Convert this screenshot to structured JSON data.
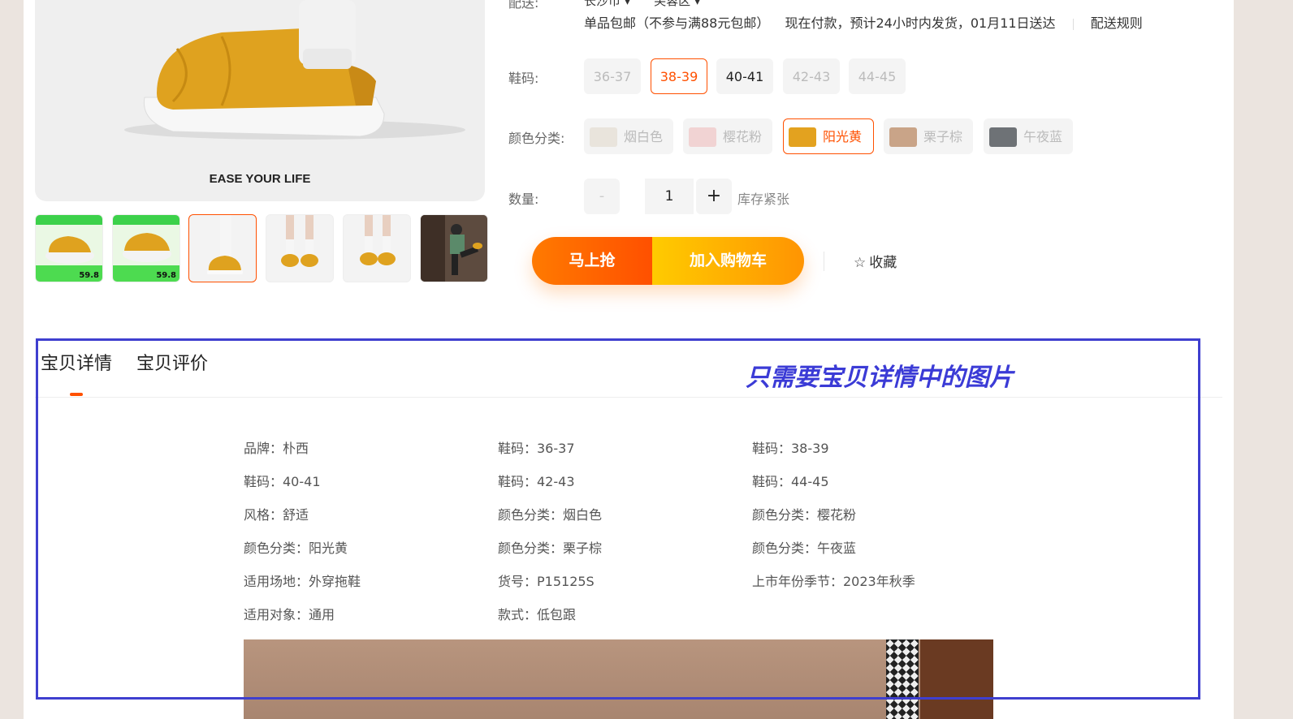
{
  "product": {
    "main_image_caption": "EASE YOUR LIFE",
    "thumbnails": [
      {
        "name": "thumb-1",
        "label": "59.8"
      },
      {
        "name": "thumb-2",
        "label": "59.8"
      },
      {
        "name": "thumb-3",
        "label": ""
      },
      {
        "name": "thumb-4",
        "label": ""
      },
      {
        "name": "thumb-5",
        "label": ""
      },
      {
        "name": "thumb-6",
        "label": ""
      }
    ],
    "selected_thumbnail_index": 3
  },
  "delivery": {
    "label": "配送:",
    "city": "长沙市",
    "district": "芙蓉区",
    "shipping_note": "单品包邮（不参与满88元包邮）",
    "dispatch_note": "现在付款，预计24小时内发货，01月11日送达",
    "rules_link": "配送规则"
  },
  "size": {
    "label": "鞋码:",
    "options": [
      "36-37",
      "38-39",
      "40-41",
      "42-43",
      "44-45"
    ],
    "selected": "38-39",
    "available": [
      "38-39",
      "40-41"
    ]
  },
  "color": {
    "label": "颜色分类:",
    "options": [
      "烟白色",
      "樱花粉",
      "阳光黄",
      "栗子棕",
      "午夜蓝"
    ],
    "selected": "阳光黄",
    "swatch_colors": [
      "#e9e4dc",
      "#f1d3d3",
      "#e3a21f",
      "#c9a488",
      "#6e7276"
    ]
  },
  "quantity": {
    "label": "数量:",
    "minus": "-",
    "value": "1",
    "plus": "+",
    "stock_note": "库存紧张"
  },
  "actions": {
    "buy_now": "马上抢",
    "add_to_cart": "加入购物车",
    "favorite": "收藏",
    "favorite_icon": "☆"
  },
  "tabs": {
    "items": [
      "宝贝详情",
      "宝贝评价"
    ],
    "active": "宝贝详情"
  },
  "attributes": [
    [
      "品牌：朴西",
      "鞋码：36-37",
      "鞋码：38-39"
    ],
    [
      "鞋码：40-41",
      "鞋码：42-43",
      "鞋码：44-45"
    ],
    [
      "风格：舒适",
      "颜色分类：烟白色",
      "颜色分类：樱花粉"
    ],
    [
      "颜色分类：阳光黄",
      "颜色分类：栗子棕",
      "颜色分类：午夜蓝"
    ],
    [
      "适用场地：外穿拖鞋",
      "货号：P15125S",
      "上市年份季节：2023年秋季"
    ],
    [
      "适用对象：通用",
      "款式：低包跟",
      ""
    ]
  ],
  "annotation": {
    "text": "只需要宝贝详情中的图片",
    "color": "#3b3bd6"
  },
  "colors": {
    "accent": "#ff5000",
    "buy_gradient": [
      "#ff7a00",
      "#ff5000"
    ],
    "cart_gradient": [
      "#ffcb00",
      "#ff9402"
    ]
  }
}
